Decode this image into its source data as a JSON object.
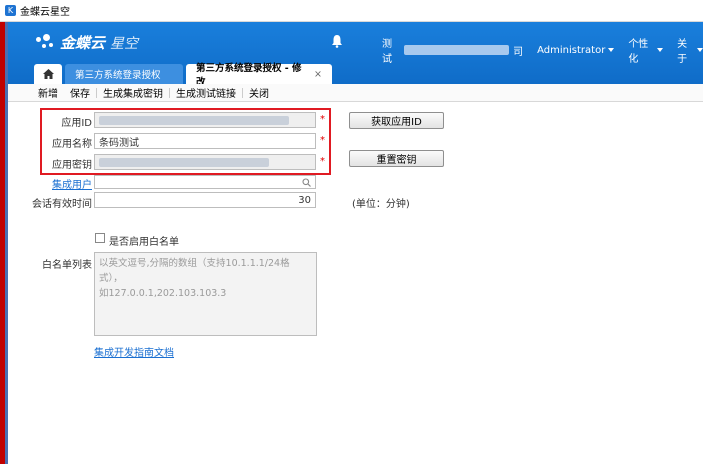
{
  "window": {
    "title": "金蝶云星空"
  },
  "header": {
    "brand": "金蝶云",
    "brand_sub": "星空",
    "user_prefix": "测试",
    "user_suffix": "司",
    "user_name": "Administrator",
    "menu_personalize": "个性化",
    "menu_about": "关于"
  },
  "tabs": [
    {
      "label": "第三方系统登录授权"
    },
    {
      "label": "第三方系统登录授权 - 修改",
      "close": "×"
    }
  ],
  "toolbar": {
    "new": "新增",
    "save": "保存",
    "gen_key": "生成集成密钥",
    "gen_link": "生成测试链接",
    "close": "关闭"
  },
  "form": {
    "app_id_label": "应用ID",
    "app_name_label": "应用名称",
    "app_name_value": "条码测试",
    "app_secret_label": "应用密钥",
    "user_label": "集成用户",
    "timeout_label": "会话有效时间",
    "timeout_value": "30",
    "timeout_unit": "(单位：分钟)",
    "get_app_id_btn": "获取应用ID",
    "reset_key_btn": "重置密钥",
    "whitelist_checkbox_label": "是否启用白名单",
    "whitelist_label": "白名单列表",
    "whitelist_placeholder_1": "以英文逗号,分隔的数组（支持10.1.1.1/24格式），",
    "whitelist_placeholder_2": "如127.0.0.1,202.103.103.3",
    "guide_link": "集成开发指南文档",
    "required_mark": "*"
  },
  "colors": {
    "header_blue": "#1a7fdc",
    "highlight_red": "#e01a22",
    "link_blue": "#1a6fd1",
    "required_red": "#e00000"
  },
  "icons": [
    "app-icon",
    "bell-icon",
    "home-icon",
    "search-icon",
    "close-icon",
    "chevron-down-icon"
  ]
}
